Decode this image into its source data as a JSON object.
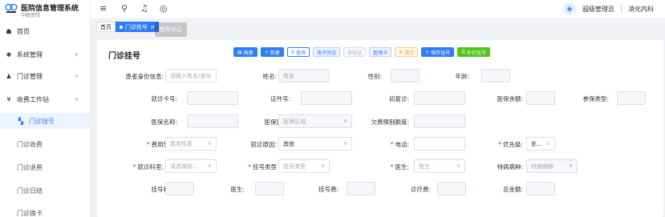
{
  "app": {
    "title": "医院信息管理系统",
    "subtitle": "中联医院"
  },
  "sidebar": {
    "items": [
      {
        "icon": "home-icon",
        "label": "首页"
      },
      {
        "icon": "gear-icon",
        "label": "系统管理"
      },
      {
        "icon": "user-icon",
        "label": "门诊管理"
      },
      {
        "icon": "yen-icon",
        "label": "收费工作站"
      }
    ],
    "subitems": [
      {
        "label": "门诊挂号"
      },
      {
        "label": "门诊收费"
      },
      {
        "label": "门诊退费"
      },
      {
        "label": "门诊日结"
      },
      {
        "label": "门诊换卡"
      }
    ]
  },
  "topbar": {
    "user": "超级管理员",
    "dept": "消化内科"
  },
  "tabs": [
    {
      "label": "首页"
    },
    {
      "label": "门诊挂号"
    }
  ],
  "ghost_tab": "挂号中心",
  "page": {
    "title": "门诊挂号",
    "buttons": [
      "档案",
      "新建",
      "查询",
      "电子凭证",
      "身份证",
      "医保卡",
      "清空",
      "保存挂号",
      "补打挂号"
    ]
  },
  "form": {
    "r1": {
      "l1": "患者身份信息:",
      "p1": "请输入姓名/身份",
      "l2": "姓名:",
      "p2": "姓名",
      "l3": "性别:",
      "l4": "年龄:"
    },
    "r2": {
      "l1": "就诊卡号:",
      "l2": "证件号:",
      "l3": "初复诊:",
      "l4": "医保余额:",
      "l5": "参保类型:"
    },
    "r3": {
      "l1": "医保名称:",
      "l2": "医保区域:",
      "p2": "医保区域",
      "l3": "欠费限制额度:"
    },
    "r4": {
      "l1": "费用性质:",
      "p1": "费用性质",
      "l2": "就诊原因:",
      "v2": "其他",
      "l3": "电话:",
      "l4": "优先级:",
      "v4": "优..."
    },
    "r5": {
      "l1": "就诊科室:",
      "p1": "请选择就...",
      "l2": "挂号类型",
      "p2": "挂号类型",
      "l3": "医生:",
      "p3": "医生",
      "l4": "特病病种:",
      "p4": "特病病种"
    },
    "r6": {
      "l1": "挂号科室:",
      "l2": "医生:",
      "l3": "挂号费:",
      "l4": "诊疗费:",
      "l5": "总金额:"
    }
  }
}
